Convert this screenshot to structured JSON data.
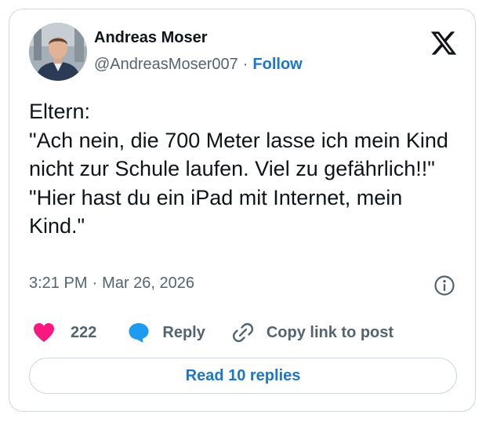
{
  "author": {
    "name": "Andreas Moser",
    "handle": "@AndreasMoser007",
    "separator": "·",
    "follow_label": "Follow"
  },
  "post": {
    "text": "Eltern:\n\"Ach nein, die 700 Meter lasse ich mein Kind nicht zur Schule laufen. Viel zu gefährlich!!\"\n\"Hier hast du ein iPad mit Internet, mein Kind.\"",
    "time": "3:21 PM",
    "separator": "·",
    "date": "Mar 26, 2026"
  },
  "actions": {
    "like_count": "222",
    "reply_label": "Reply",
    "copy_link_label": "Copy link to post"
  },
  "read_replies_label": "Read 10 replies",
  "icons": {
    "logo": "x-logo-icon",
    "info": "info-icon",
    "like": "heart-icon",
    "reply": "speech-bubble-icon",
    "copy": "link-icon"
  },
  "colors": {
    "like": "#f91880",
    "reply": "#1d9bf0",
    "link_accent": "#1d77c6",
    "secondary_text": "#536471",
    "border": "#cfd9de"
  }
}
